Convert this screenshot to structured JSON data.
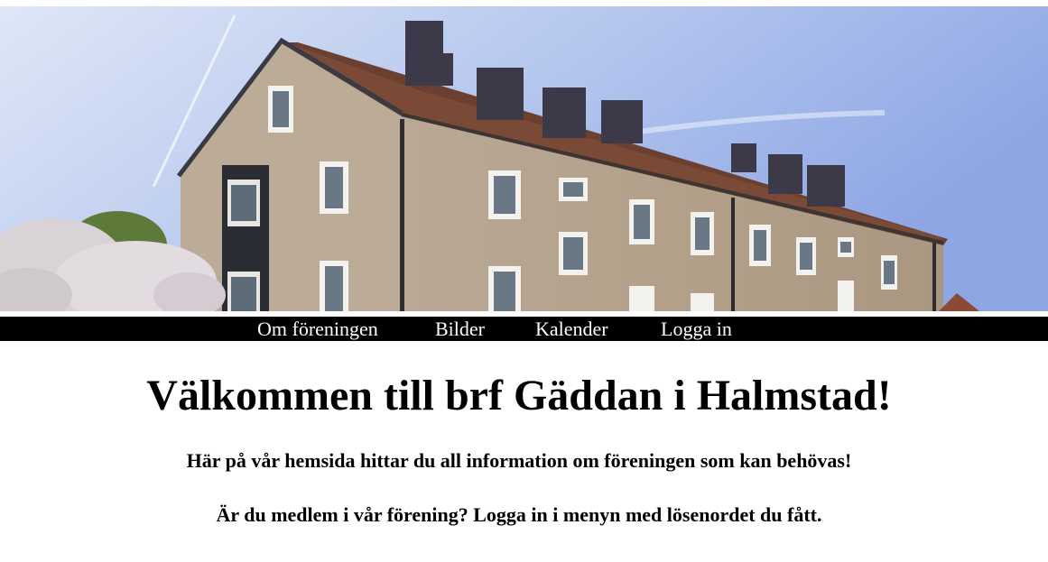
{
  "hero": {
    "image_name": "building-photo",
    "colors": {
      "sky_top": "#8fa8e6",
      "sky_bottom": "#dde6f7",
      "brick": "#b8a690",
      "roof": "#6a3e2c",
      "chimney": "#3c3a48"
    }
  },
  "nav": {
    "items": [
      {
        "label": "Om föreningen"
      },
      {
        "label": "Bilder"
      },
      {
        "label": "Kalender"
      },
      {
        "label": "Logga in"
      }
    ]
  },
  "main": {
    "title": "Välkommen till brf Gäddan i Halmstad!",
    "intro": "Här på vår hemsida hittar du all information om föreningen som kan behövas!",
    "members_note": "Är du medlem i vår förening? Logga in i menyn med lösenordet du fått."
  }
}
